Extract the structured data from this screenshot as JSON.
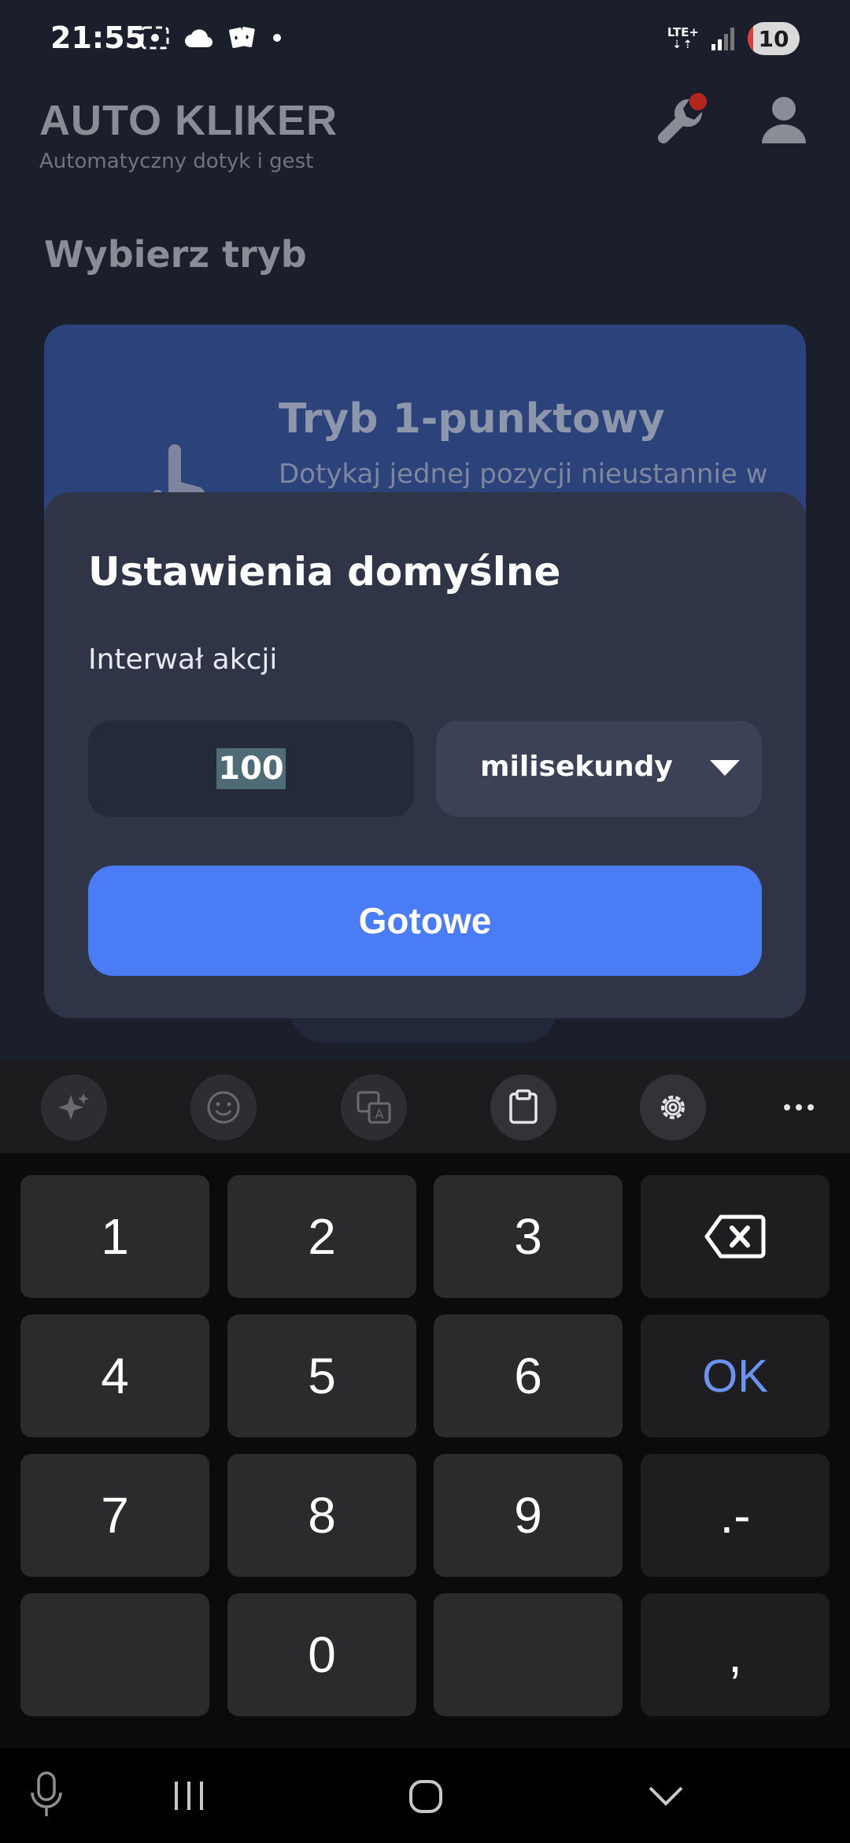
{
  "status_bar": {
    "time": "21:55",
    "network": "LTE+",
    "battery_level": "10",
    "battery_fraction": 0.1
  },
  "app": {
    "title": "AUTO KLIKER",
    "subtitle": "Automatyczny dotyk i gest",
    "section_title": "Wybierz tryb",
    "mode_card": {
      "title": "Tryb 1-punktowy",
      "description": "Dotykaj jednej pozycji nieustannie w"
    }
  },
  "dialog": {
    "title": "Ustawienia domyślne",
    "interval_label": "Interwał akcji",
    "interval_value": "100",
    "unit_selected": "milisekundy",
    "done_label": "Gotowe"
  },
  "keyboard": {
    "toolbar": [
      "ai-sparkle-icon",
      "emoji-icon",
      "translate-icon",
      "clipboard-icon",
      "settings-icon",
      "more-icon"
    ],
    "keys": {
      "k1": "1",
      "k2": "2",
      "k3": "3",
      "k4": "4",
      "k5": "5",
      "k6": "6",
      "ok": "OK",
      "k7": "7",
      "k8": "8",
      "k9": "9",
      "dot_dash": ".-",
      "k0": "0",
      "comma": ","
    }
  },
  "colors": {
    "accent": "#4a7cf6",
    "dialog_bg": "#2f3547",
    "mode_card": "#2b437a",
    "ok_key": "#6b93f0",
    "badge": "#b3261e"
  }
}
